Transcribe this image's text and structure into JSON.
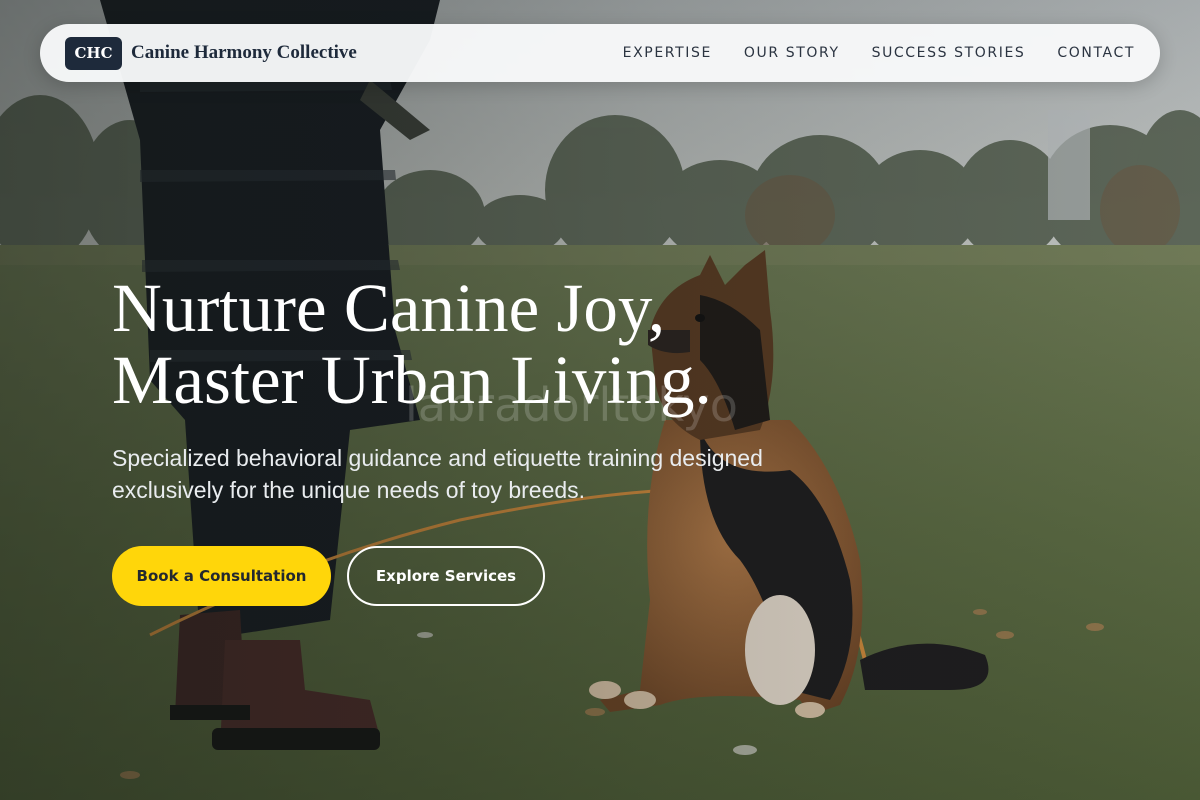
{
  "brand": {
    "badge": "CHC",
    "name": "Canine Harmony Collective"
  },
  "nav": {
    "items": [
      {
        "label": "EXPERTISE"
      },
      {
        "label": "OUR STORY"
      },
      {
        "label": "SUCCESS STORIES"
      },
      {
        "label": "CONTACT"
      }
    ]
  },
  "hero": {
    "headline_line1": "Nurture Canine Joy,",
    "headline_line2": "Master Urban Living.",
    "watermark": "labradorltokyo",
    "subtitle": "Specialized behavioral guidance and etiquette training designed exclusively for the unique needs of toy breeds.",
    "primary_cta": "Book a Consultation",
    "secondary_cta": "Explore Services"
  },
  "colors": {
    "accent": "#ffd60a",
    "brand_dark": "#1e2a3b",
    "nav_background": "#f8f9fa"
  }
}
